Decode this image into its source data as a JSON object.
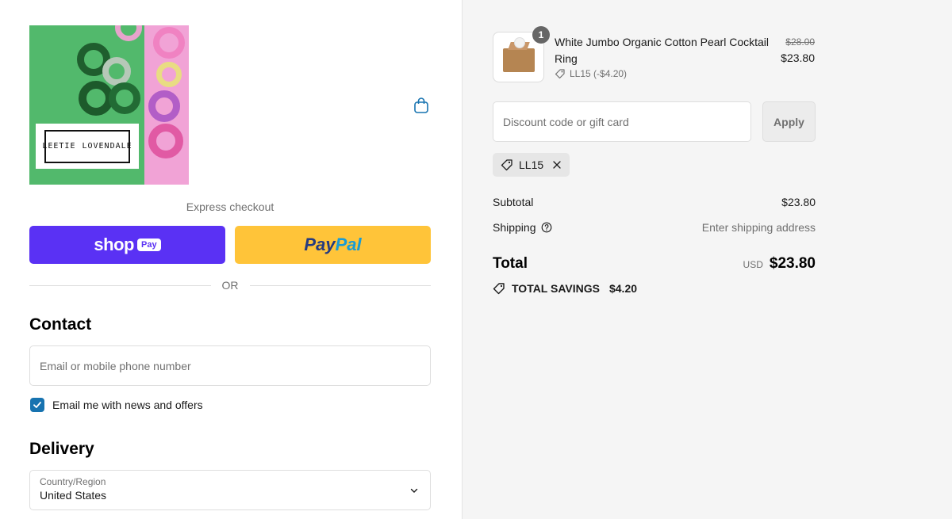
{
  "brand": {
    "logo_text_1": "LEETIE",
    "logo_text_2": "LOVENDALE"
  },
  "express": {
    "label": "Express checkout",
    "shop_pay_text": "shop",
    "shop_pay_pill": "Pay",
    "paypal_text_1": "Pay",
    "paypal_text_2": "Pal",
    "divider": "OR"
  },
  "contact": {
    "title": "Contact",
    "email_placeholder": "Email or mobile phone number",
    "email_value": "",
    "newsletter_label": "Email me with news and offers",
    "newsletter_checked": true
  },
  "delivery": {
    "title": "Delivery",
    "country_label": "Country/Region",
    "country_value": "United States"
  },
  "order": {
    "product": {
      "quantity": "1",
      "name": "White Jumbo Organic Cotton Pearl Cocktail Ring",
      "discount": "LL15 (-$4.20)",
      "price_original": "$28.00",
      "price_final": "$23.80"
    },
    "discount_placeholder": "Discount code or gift card",
    "apply_label": "Apply",
    "applied_code": "LL15",
    "subtotal_label": "Subtotal",
    "subtotal_value": "$23.80",
    "shipping_label": "Shipping",
    "shipping_value": "Enter shipping address",
    "total_label": "Total",
    "currency": "USD",
    "total_value": "$23.80",
    "savings_label": "TOTAL SAVINGS",
    "savings_value": "$4.20"
  },
  "colors": {
    "shop_pay": "#5a31f4",
    "paypal": "#ffc439",
    "accent": "#1773b0"
  }
}
